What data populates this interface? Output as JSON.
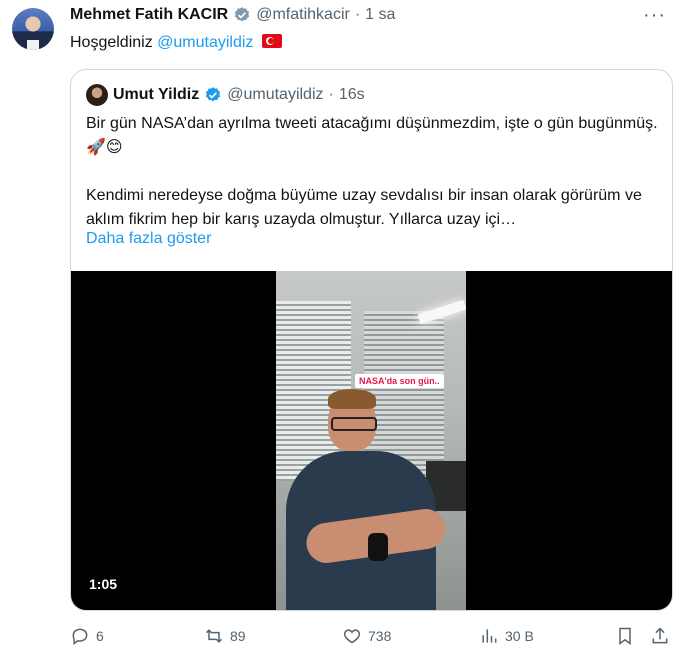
{
  "author": {
    "name": "Mehmet Fatih KACIR",
    "handle": "@mfatihkacir",
    "separator": "·",
    "time": "1 sa"
  },
  "tweet": {
    "text_prefix": "Hoşgeldiniz ",
    "mention": "@umutayildiz",
    "flag_icon": "turkey-flag-icon"
  },
  "quoted": {
    "name": "Umut Yildiz",
    "handle": "@umutayildiz",
    "separator": "·",
    "time": "16s",
    "line1": "Bir gün NASA’dan ayrılma tweeti atacağımı düşünmezdim, işte o gün bugünmüş. 🚀😊",
    "line2": "Kendimi neredeyse doğma büyüme uzay sevdalısı bir insan olarak görürüm ve aklım fikrim hep bir karış uzayda olmuştur. Yıllarca uzay içi…",
    "show_more": "Daha fazla göster",
    "video": {
      "sticker": "NASA'da son gün..",
      "duration": "1:05"
    }
  },
  "actions": {
    "replies": "6",
    "retweets": "89",
    "likes": "738",
    "views": "30 B"
  },
  "colors": {
    "accent": "#1d9bf0",
    "muted": "#536471"
  }
}
